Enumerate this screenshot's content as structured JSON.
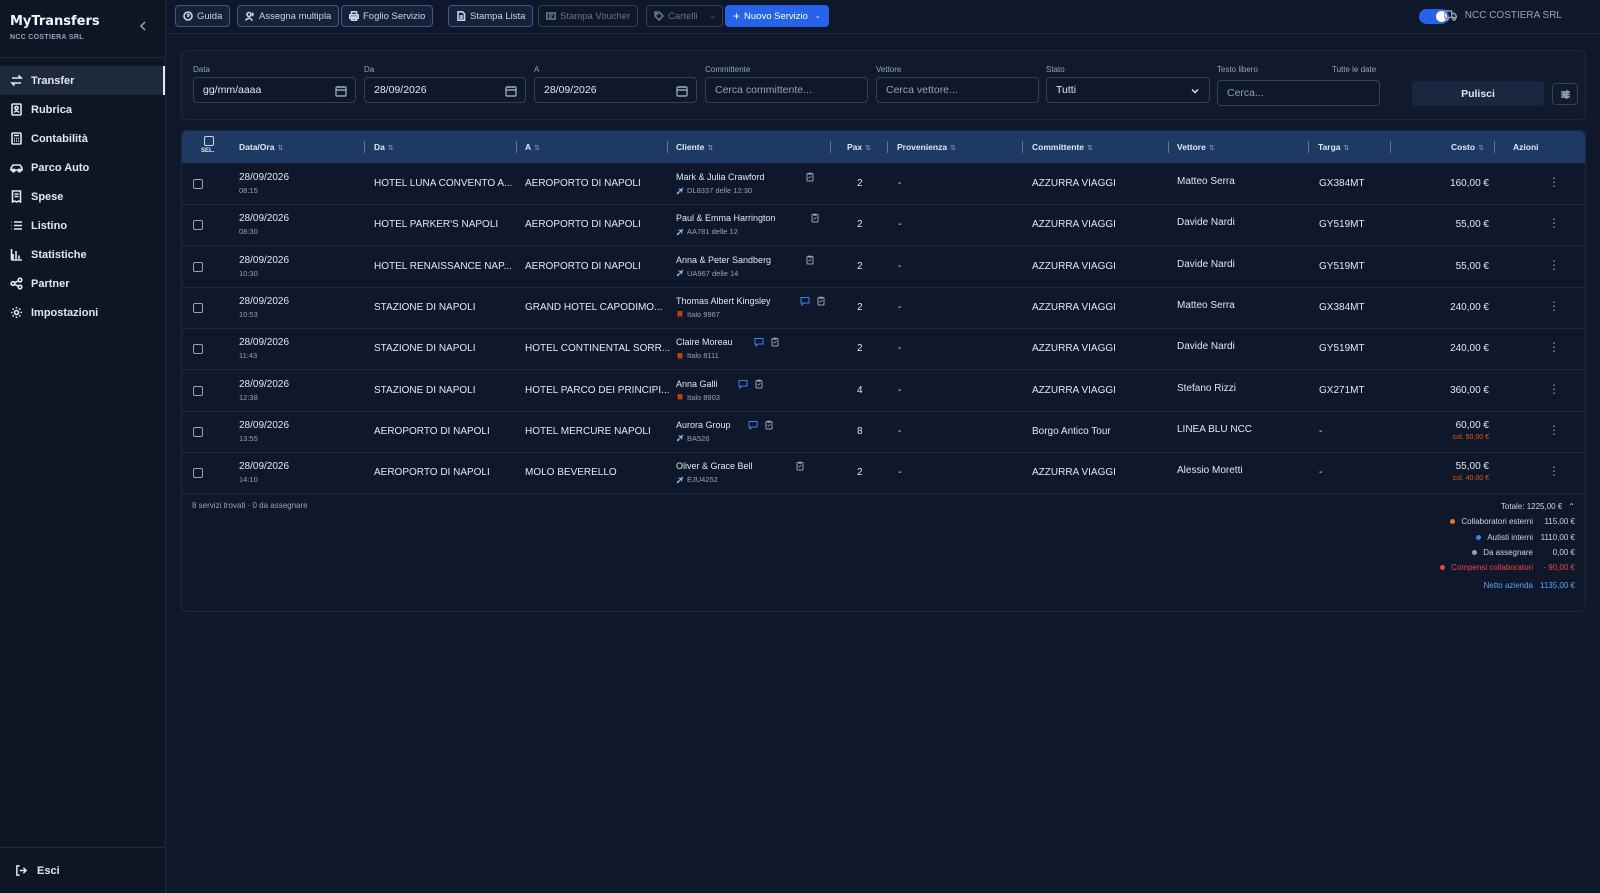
{
  "app": {
    "title": "MyTransfers",
    "subtitle": "NCC COSTIERA SRL"
  },
  "nav": [
    {
      "label": "Transfer",
      "icon": "arrows-swap-icon",
      "active": true
    },
    {
      "label": "Rubrica",
      "icon": "address-book-icon"
    },
    {
      "label": "Contabilità",
      "icon": "calculator-icon"
    },
    {
      "label": "Parco Auto",
      "icon": "car-icon"
    },
    {
      "label": "Spese",
      "icon": "receipt-icon"
    },
    {
      "label": "Listino",
      "icon": "list-icon"
    },
    {
      "label": "Statistiche",
      "icon": "bar-chart-icon"
    },
    {
      "label": "Partner",
      "icon": "share-icon"
    },
    {
      "label": "Impostazioni",
      "icon": "gear-icon"
    }
  ],
  "logout": "Esci",
  "toolbar": {
    "guide": "Guida",
    "multi_assign": "Assegna multipla",
    "service_sheet": "Foglio Servizio",
    "print_list": "Stampa Lista",
    "print_voucher": "Stampa Voucher",
    "signs": "Cartelli",
    "new_service": "Nuovo Servizio",
    "company": "NCC COSTIERA SRL"
  },
  "filters": {
    "date_label": "Data",
    "date_value": "gg/mm/aaaa",
    "from_label": "Da",
    "from_value": "28/09/2026",
    "to_label": "A",
    "to_value": "28/09/2026",
    "client_label": "Committente",
    "client_placeholder": "Cerca committente...",
    "carrier_label": "Vettore",
    "carrier_placeholder": "Cerca vettore...",
    "status_label": "Stato",
    "status_value": "Tutti",
    "text_label": "Testo libero",
    "text_placeholder": "Cerca...",
    "all_dates_label": "Tutte le date",
    "clear": "Pulisci"
  },
  "table": {
    "headers": {
      "sel": "SEL.",
      "datetime": "Data/Ora",
      "from": "Da",
      "to": "A",
      "customer": "Cliente",
      "pax": "Pax",
      "origin": "Provenienza",
      "client": "Committente",
      "carrier": "Vettore",
      "plate": "Targa",
      "cost": "Costo",
      "actions": "Azioni"
    },
    "rows": [
      {
        "date": "28/09/2026",
        "time": "08:15",
        "from": "HOTEL LUNA CONVENTO A...",
        "to": "AEROPORTO DI NAPOLI",
        "customer": "Mark & Julia Crawford",
        "ref": "DL8337 delle 12:30",
        "ref_type": "flight",
        "msg": false,
        "pax": "2",
        "origin": "-",
        "client": "AZZURRA VIAGGI",
        "carrier": "Matteo Serra",
        "plate": "GX384MT",
        "cost": "160,00 €",
        "note": ""
      },
      {
        "date": "28/09/2026",
        "time": "08:30",
        "from": "HOTEL PARKER'S NAPOLI",
        "to": "AEROPORTO DI NAPOLI",
        "customer": "Paul & Emma Harrington",
        "ref": "AA781 delle 12",
        "ref_type": "flight",
        "msg": false,
        "pax": "2",
        "origin": "-",
        "client": "AZZURRA VIAGGI",
        "carrier": "Davide Nardi",
        "plate": "GY519MT",
        "cost": "55,00 €",
        "note": ""
      },
      {
        "date": "28/09/2026",
        "time": "10:30",
        "from": "HOTEL RENAISSANCE NAP...",
        "to": "AEROPORTO DI NAPOLI",
        "customer": "Anna & Peter Sandberg",
        "ref": "UA967 delle 14",
        "ref_type": "flight",
        "msg": false,
        "pax": "2",
        "origin": "-",
        "client": "AZZURRA VIAGGI",
        "carrier": "Davide Nardi",
        "plate": "GY519MT",
        "cost": "55,00 €",
        "note": ""
      },
      {
        "date": "28/09/2026",
        "time": "10:53",
        "from": "STAZIONE DI NAPOLI",
        "to": "GRAND HOTEL CAPODIMO...",
        "customer": "Thomas Albert Kingsley",
        "ref": "Italo 9967",
        "ref_type": "train",
        "msg": true,
        "pax": "2",
        "origin": "-",
        "client": "AZZURRA VIAGGI",
        "carrier": "Matteo Serra",
        "plate": "GX384MT",
        "cost": "240,00 €",
        "note": ""
      },
      {
        "date": "28/09/2026",
        "time": "11:43",
        "from": "STAZIONE DI NAPOLI",
        "to": "HOTEL CONTINENTAL SORR...",
        "customer": "Claire Moreau",
        "ref": "Italo 8111",
        "ref_type": "train",
        "msg": true,
        "pax": "2",
        "origin": "-",
        "client": "AZZURRA VIAGGI",
        "carrier": "Davide Nardi",
        "plate": "GY519MT",
        "cost": "240,00 €",
        "note": ""
      },
      {
        "date": "28/09/2026",
        "time": "12:38",
        "from": "STAZIONE DI NAPOLI",
        "to": "HOTEL PARCO DEI PRINCIPI...",
        "customer": "Anna Galli",
        "ref": "Italo 8903",
        "ref_type": "train",
        "msg": true,
        "pax": "4",
        "origin": "-",
        "client": "AZZURRA VIAGGI",
        "carrier": "Stefano Rizzi",
        "plate": "GX271MT",
        "cost": "360,00 €",
        "note": ""
      },
      {
        "date": "28/09/2026",
        "time": "13:55",
        "from": "AEROPORTO DI NAPOLI",
        "to": "HOTEL MERCURE NAPOLI",
        "customer": "Aurora Group",
        "ref": "BA526",
        "ref_type": "flight",
        "msg": true,
        "pax": "8",
        "origin": "-",
        "client": "Borgo Antico Tour",
        "carrier": "LINEA BLU NCC",
        "plate": "-",
        "cost": "60,00 €",
        "note": "col. 50,00 €"
      },
      {
        "date": "28/09/2026",
        "time": "14:10",
        "from": "AEROPORTO DI NAPOLI",
        "to": "MOLO BEVERELLO",
        "customer": "Oliver & Grace Bell",
        "ref": "EJU4252",
        "ref_type": "flight",
        "msg": false,
        "pax": "2",
        "origin": "-",
        "client": "AZZURRA VIAGGI",
        "carrier": "Alessio Moretti",
        "plate": "-",
        "cost": "55,00 €",
        "note": "col. 40,00 €"
      }
    ],
    "footer": "8 servizi trovati · 0 da assegnare"
  },
  "summary": {
    "total": "Totale: 1225,00 €",
    "items": [
      {
        "label": "Collaboratori esterni",
        "value": "115,00 €",
        "color": "#f97316"
      },
      {
        "label": "Autisti interni",
        "value": "1110,00 €",
        "color": "#3b82f6"
      },
      {
        "label": "Da assegnare",
        "value": "0,00 €",
        "color": "#94a3b8"
      },
      {
        "label": "Compensi collaboratori",
        "value": "- 90,00 €",
        "color": "#ef4444"
      }
    ],
    "net_label": "Netto azienda",
    "net_value": "1135,00 €"
  }
}
